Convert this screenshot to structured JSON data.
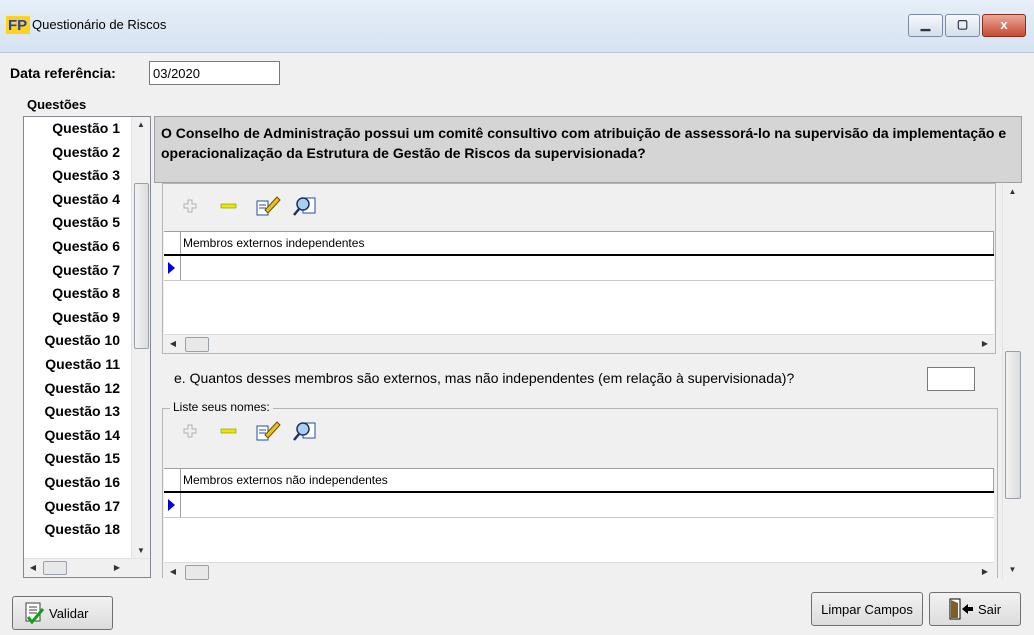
{
  "window": {
    "title": "Questionário de Riscos",
    "controls": {
      "minimize": "▁",
      "maximize": "▢",
      "close": "x"
    }
  },
  "date_ref": {
    "label": "Data referência:",
    "value": "03/2020"
  },
  "questions": {
    "label": "Questões",
    "items": [
      "Questão 1",
      "Questão 2",
      "Questão 3",
      "Questão 4",
      "Questão 5",
      "Questão 6",
      "Questão 7",
      "Questão 8",
      "Questão 9",
      "Questão 10",
      "Questão 11",
      "Questão 12",
      "Questão 13",
      "Questão 14",
      "Questão 15",
      "Questão 16",
      "Questão 17",
      "Questão 18"
    ],
    "selected": "Questão 1"
  },
  "question_text": "O Conselho de Administração possui um comitê consultivo com atribuição de assessorá-lo na supervisão da implementação e operacionalização da Estrutura de Gestão de Riscos da supervisionada?",
  "grid1": {
    "column": "Membros externos independentes"
  },
  "question_e": {
    "text": "e. Quantos desses membros são externos, mas não independentes (em relação à supervisionada)?",
    "value": ""
  },
  "group2": {
    "legend": "Liste seus nomes:"
  },
  "grid2": {
    "column": "Membros externos não independentes"
  },
  "toolbar_icons": [
    "add-icon",
    "remove-icon",
    "edit-icon",
    "search-icon"
  ],
  "buttons": {
    "validar": "Validar",
    "limpar": "Limpar Campos",
    "sair": "Sair"
  },
  "colors": {
    "header_bg": "#d5d5d5",
    "grid_indicator": "#0000e0",
    "window_bg": "#f0f0f0"
  }
}
